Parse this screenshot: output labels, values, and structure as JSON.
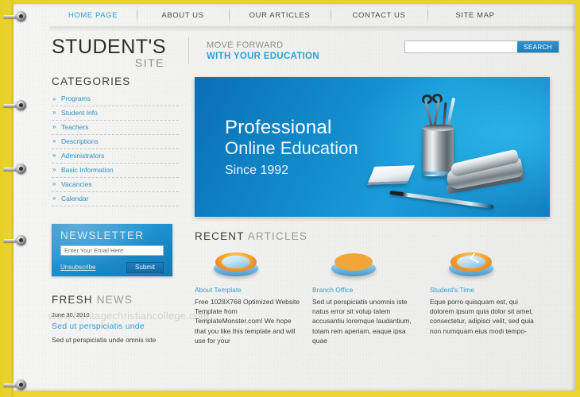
{
  "nav": {
    "items": [
      {
        "label": "HOME PAGE",
        "active": true
      },
      {
        "label": "ABOUT US",
        "active": false
      },
      {
        "label": "OUR ARTICLES",
        "active": false
      },
      {
        "label": "CONTACT US",
        "active": false
      },
      {
        "label": "SITE MAP",
        "active": false
      }
    ]
  },
  "header": {
    "logo_primary": "STUDENT'S",
    "logo_secondary": "SITE",
    "tagline_line1": "MOVE FORWARD",
    "tagline_line2": "WITH YOUR EDUCATION",
    "search": {
      "value": "",
      "placeholder": "",
      "button_label": "SEARCH"
    }
  },
  "sidebar": {
    "categories_title": "CATEGORIES",
    "categories": [
      {
        "label": "Programs"
      },
      {
        "label": "Student Info"
      },
      {
        "label": "Teachers"
      },
      {
        "label": "Descriptions"
      },
      {
        "label": "Administrators"
      },
      {
        "label": "Basic Information"
      },
      {
        "label": "Vacancies"
      },
      {
        "label": "Calendar"
      }
    ],
    "newsletter": {
      "title": "NEWSLETTER",
      "input_value": "Enter Your Email Here",
      "unsubscribe_label": "Unsubscribe",
      "submit_label": "Submit"
    },
    "fresh_news": {
      "title_strong": "FRESH",
      "title_dim": "NEWS",
      "watermark": "www.heritagechristiancollege.com",
      "date": "June 30, 2010",
      "link": "Sed ut perspiciatis unde",
      "text": "Sed ut perspiciatis unde omnis iste"
    }
  },
  "hero": {
    "line1": "Professional",
    "line2": "Online Education",
    "line3": "Since 1992"
  },
  "recent": {
    "title_strong": "RECENT",
    "title_dim": "ARTICLES",
    "articles": [
      {
        "icon": "disc-icon",
        "title": "About Template",
        "text": "Free 1028X768 Optimized Website Template from TemplateMonster.com! We hope that you like this template and will use for your"
      },
      {
        "icon": "globe-icon",
        "title": "Branch Office",
        "text": "Sed ut perspiciatis unomnis iste natus error sit volup tatem accusantiu loremque laudantium, totam rem aperiam, eaque ipsa quae"
      },
      {
        "icon": "clock-icon",
        "title": "Student's Time",
        "text": "Eque porro quisquam est, qui dolorem ipsum quia dolor sit amet, consectetur, adipisci velit, sed quia non numquam eius modi tempo-"
      }
    ]
  },
  "colors": {
    "accent_blue": "#2f9fd6",
    "frame_yellow": "#e8d22e",
    "hero_blue": "#1187c8",
    "link_blue": "#2f8fc4"
  }
}
